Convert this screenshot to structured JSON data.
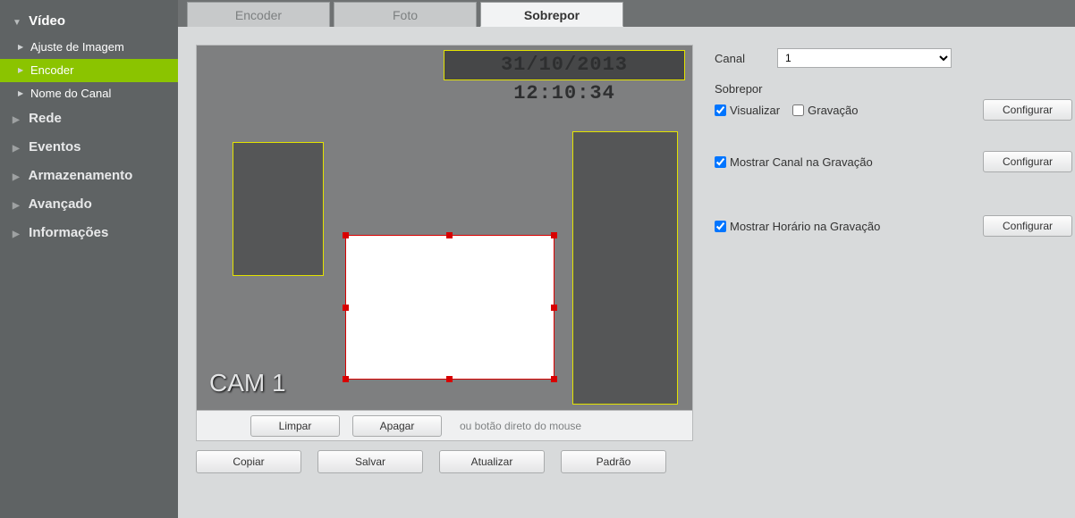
{
  "sidebar": {
    "video": "Vídeo",
    "sub": {
      "ajuste": "Ajuste de Imagem",
      "encoder": "Encoder",
      "nome": "Nome do Canal"
    },
    "rede": "Rede",
    "eventos": "Eventos",
    "armazenamento": "Armazenamento",
    "avancado": "Avançado",
    "informacoes": "Informações"
  },
  "tabs": {
    "encoder": "Encoder",
    "foto": "Foto",
    "sobrepor": "Sobrepor"
  },
  "preview": {
    "timestamp": "31/10/2013 12:10:34",
    "cam_label": "CAM 1",
    "bar": {
      "limpar": "Limpar",
      "apagar": "Apagar",
      "hint": "ou botão direto do mouse"
    },
    "buttons": {
      "copiar": "Copiar",
      "salvar": "Salvar",
      "atualizar": "Atualizar",
      "padrao": "Padrão"
    }
  },
  "settings": {
    "canal_label": "Canal",
    "canal_value": "1",
    "sobrepor_title": "Sobrepor",
    "visualizar": "Visualizar",
    "gravacao": "Gravação",
    "configurar": "Configurar",
    "mostrar_canal": "Mostrar Canal na Gravação",
    "mostrar_hora": "Mostrar Horário na Gravação"
  }
}
